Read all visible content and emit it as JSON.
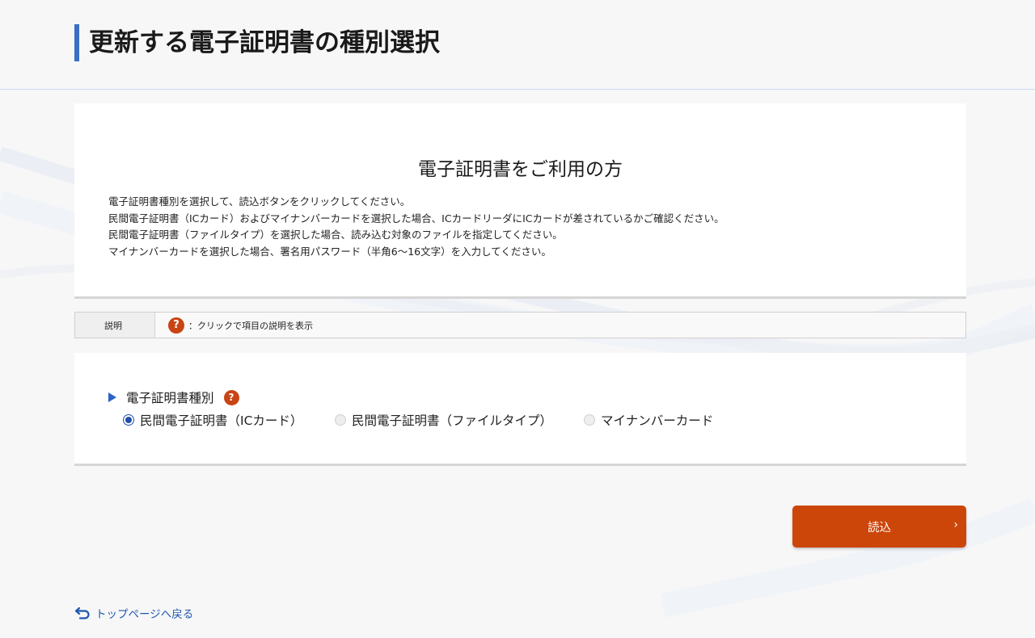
{
  "header": {
    "title": "更新する電子証明書の種別選択"
  },
  "info": {
    "heading": "電子証明書をご利用の方",
    "lines": [
      "電子証明書種別を選択して、読込ボタンをクリックしてください。",
      "民間電子証明書（ICカード）およびマイナンバーカードを選択した場合、ICカードリーダにICカードが差されているかご確認ください。",
      "民間電子証明書（ファイルタイプ）を選択した場合、読み込む対象のファイルを指定してください。",
      "マイナンバーカードを選択した場合、署名用パスワード（半角6～16文字）を入力してください。"
    ]
  },
  "legend": {
    "label": "説明",
    "icon_symbol": "?",
    "text": "：クリックで項目の説明を表示"
  },
  "form": {
    "field_label": "電子証明書種別",
    "help_symbol": "?",
    "options": [
      {
        "label": "民間電子証明書（ICカード）",
        "selected": true
      },
      {
        "label": "民間電子証明書（ファイルタイプ）",
        "selected": false
      },
      {
        "label": "マイナンバーカード",
        "selected": false
      }
    ]
  },
  "actions": {
    "read_label": "読込",
    "read_chevron": "›"
  },
  "footer": {
    "back_label": "トップページへ戻る"
  },
  "colors": {
    "accent": "#3a6fc4",
    "button": "#cc4509",
    "help_icon": "#c94414",
    "link": "#1f57b0"
  }
}
